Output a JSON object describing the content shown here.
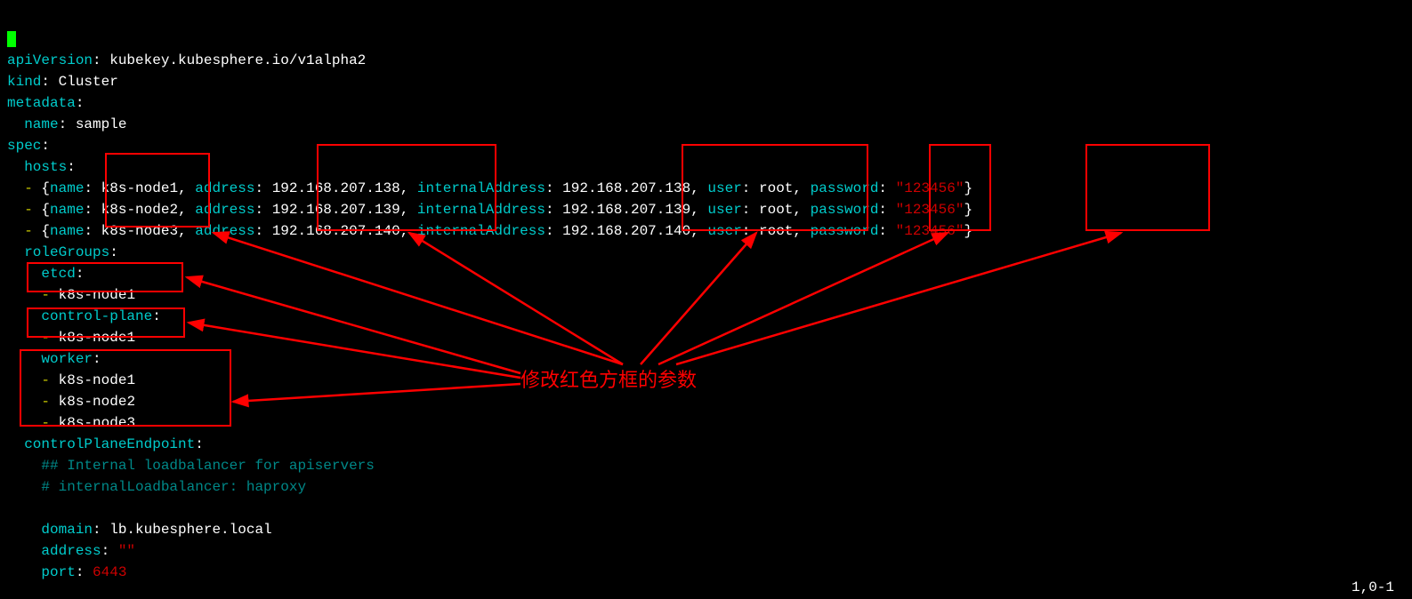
{
  "yaml": {
    "apiVersion_key": "apiVersion",
    "apiVersion_val": "kubekey.kubesphere.io/v1alpha2",
    "kind_key": "kind",
    "kind_val": "Cluster",
    "metadata_key": "metadata",
    "name_key": "name",
    "name_val": "sample",
    "spec_key": "spec",
    "hosts_key": "hosts",
    "hosts": [
      {
        "name": "k8s-node1",
        "address": "192.168.207.138",
        "internal": "192.168.207.138",
        "user": "root",
        "password": "\"123456\""
      },
      {
        "name": "k8s-node2",
        "address": "192.168.207.139",
        "internal": "192.168.207.139",
        "user": "root",
        "password": "\"123456\""
      },
      {
        "name": "k8s-node3",
        "address": "192.168.207.140",
        "internal": "192.168.207.140",
        "user": "root",
        "password": "\"123456\""
      }
    ],
    "host_labels": {
      "name": "name",
      "address": "address",
      "internal": "internalAddress",
      "user": "user",
      "password": "password"
    },
    "roleGroups_key": "roleGroups",
    "etcd_key": "etcd",
    "etcd": [
      "k8s-node1"
    ],
    "controlplane_key": "control-plane",
    "controlplane": [
      "k8s-node1"
    ],
    "worker_key": "worker",
    "worker": [
      "k8s-node1",
      "k8s-node2",
      "k8s-node3"
    ],
    "controlPlaneEndpoint_key": "controlPlaneEndpoint",
    "comment1": "## Internal loadbalancer for apiservers",
    "comment2": "# internalLoadbalancer: haproxy",
    "domain_key": "domain",
    "domain_val": "lb.kubesphere.local",
    "address_key": "address",
    "address_val": "\"\"",
    "port_key": "port",
    "port_val": "6443"
  },
  "annotation": "修改红色方框的参数",
  "status": "1,0-1"
}
